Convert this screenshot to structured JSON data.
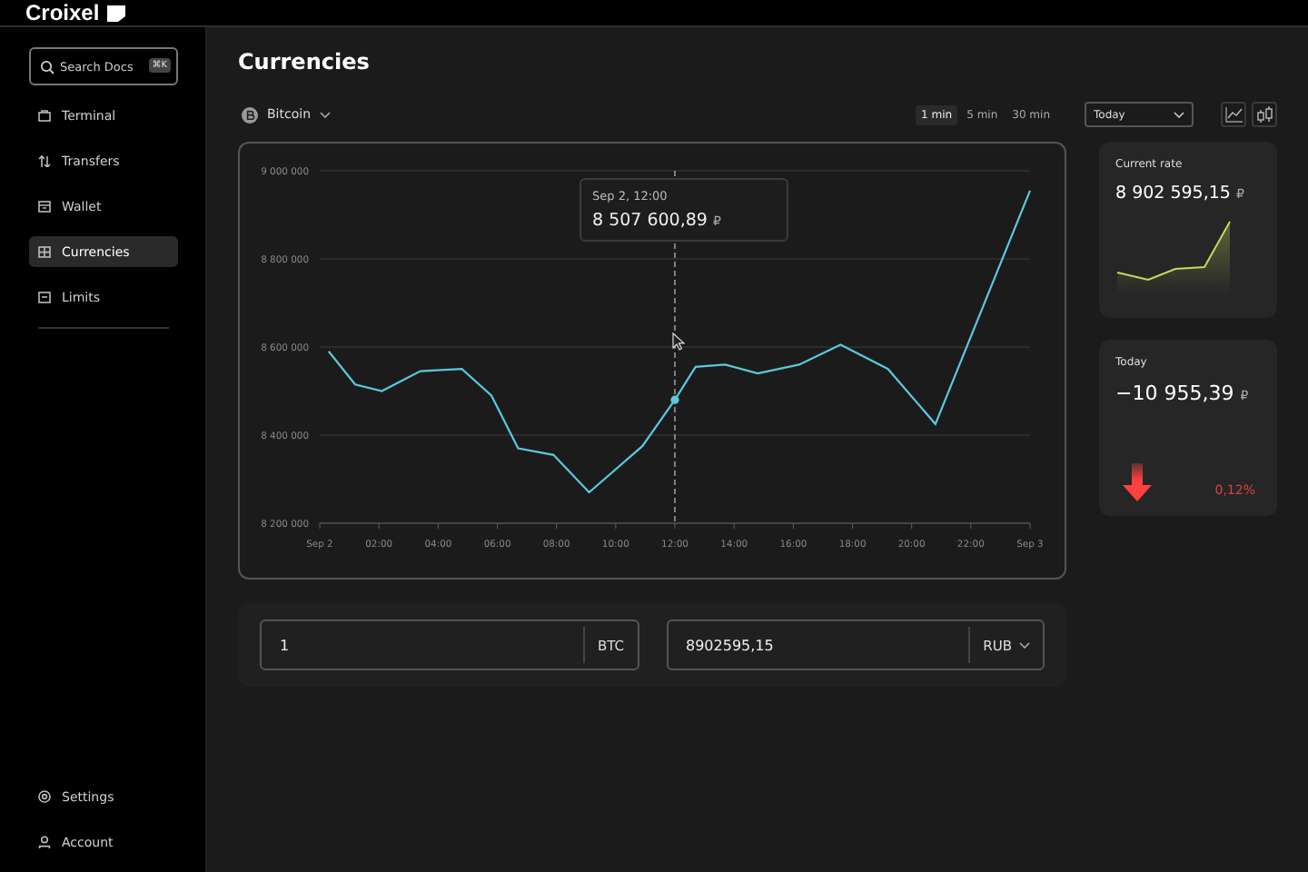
{
  "app": {
    "logo": "Croixel"
  },
  "sidebar": {
    "search": {
      "placeholder": "Search Docs",
      "shortcut": "⌘K"
    },
    "items": [
      {
        "label": "Terminal",
        "selected": false
      },
      {
        "label": "Transfers",
        "selected": false
      },
      {
        "label": "Wallet",
        "selected": false
      },
      {
        "label": "Currencies",
        "selected": true
      },
      {
        "label": "Limits",
        "selected": false
      }
    ],
    "footer_items": [
      {
        "label": "Settings",
        "selected": false
      },
      {
        "label": "Account",
        "selected": false
      }
    ]
  },
  "page": {
    "title": "Currencies"
  },
  "toolbar": {
    "intervals": [
      {
        "label": "1 min",
        "selected": true
      },
      {
        "label": "5 min",
        "selected": false
      },
      {
        "label": "30 min",
        "selected": false
      }
    ],
    "period": "Today",
    "chart_types": [
      {
        "kind": "line"
      },
      {
        "kind": "candles"
      }
    ]
  },
  "chart": {
    "tooltip": {
      "time": "Sep 2, 12:00",
      "value": "8 507 600,89",
      "currency": "₽"
    },
    "chart_data": {
      "type": "line",
      "x": [
        0.3,
        1.2,
        2.1,
        3.4,
        4.8,
        5.8,
        6.7,
        7.9,
        9.1,
        10.9,
        12,
        12.7,
        13.7,
        14.8,
        16.2,
        17.6,
        19.2,
        20.8,
        24
      ],
      "series": [
        {
          "name": "Bitcoin",
          "color": "#5bc8dc",
          "values": [
            8590000,
            8515000,
            8500000,
            8545000,
            8550000,
            8490000,
            8370000,
            8355000,
            8270000,
            8375000,
            8480000,
            8555000,
            8560000,
            8540000,
            8560000,
            8605000,
            8550000,
            8425000,
            8955000
          ]
        }
      ],
      "grid": true,
      "xlim": [
        0,
        24
      ],
      "ylim": [
        8200000,
        9000000
      ],
      "xticks": [
        {
          "value": 0,
          "label": "Sep 2"
        },
        {
          "value": 2,
          "label": "02:00"
        },
        {
          "value": 4,
          "label": "04:00"
        },
        {
          "value": 6,
          "label": "06:00"
        },
        {
          "value": 8,
          "label": "08:00"
        },
        {
          "value": 10,
          "label": "10:00"
        },
        {
          "value": 12,
          "label": "12:00"
        },
        {
          "value": 14,
          "label": "14:00"
        },
        {
          "value": 16,
          "label": "16:00"
        },
        {
          "value": 18,
          "label": "18:00"
        },
        {
          "value": 20,
          "label": "20:00"
        },
        {
          "value": 22,
          "label": "22:00"
        },
        {
          "value": 24,
          "label": "Sep 3"
        }
      ],
      "yticks": [
        {
          "value": 8200000,
          "label": "8 200 000"
        },
        {
          "value": 8400000,
          "label": "8 400 000"
        },
        {
          "value": 8600000,
          "label": "8 600 000"
        },
        {
          "value": 8800000,
          "label": "8 800 000"
        },
        {
          "value": 9000000,
          "label": "9 000 000"
        }
      ],
      "ref_lines": [
        {
          "axis": "x",
          "value": 12
        }
      ]
    }
  },
  "cards": [
    {
      "kind": "rate",
      "title": "Current rate",
      "value": "8 902 595,15",
      "currency": "₽"
    },
    {
      "kind": "change",
      "title": "Today",
      "value": "−10 955,39",
      "currency": "₽",
      "percent": "0,12%"
    }
  ],
  "converter": [
    {
      "value": "1",
      "currency": "BTC",
      "dropdown": false
    },
    {
      "value": "8902595,15",
      "currency": "RUB",
      "dropdown": true
    }
  ]
}
